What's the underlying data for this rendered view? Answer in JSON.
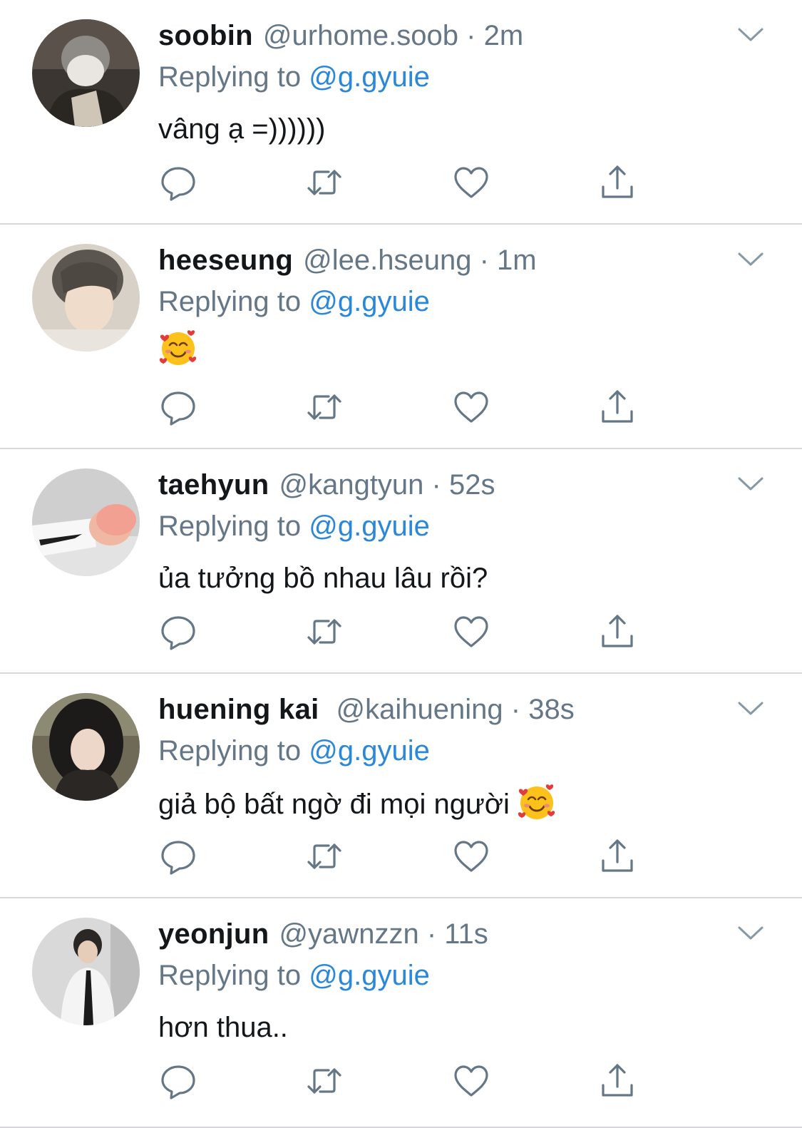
{
  "separator": "·",
  "reply_prefix": "Replying to",
  "tweets": [
    {
      "name": "soobin",
      "handle": "@urhome.soob",
      "time": "2m",
      "mention": "@g.gyuie",
      "text": "vâng ạ =))))))",
      "emoji": "",
      "avatar": "avatar-photo-masked-person"
    },
    {
      "name": "heeseung",
      "handle": "@lee.hseung",
      "time": "1m",
      "mention": "@g.gyuie",
      "text": "",
      "emoji": "smiling-face-with-hearts",
      "avatar": "avatar-photo-selfie"
    },
    {
      "name": "taehyun",
      "handle": "@kangtyun",
      "time": "52s",
      "mention": "@g.gyuie",
      "text": "ủa tưởng bồ nhau lâu rồi?",
      "emoji": "",
      "avatar": "avatar-photo-pink-hair"
    },
    {
      "name": "huening kai",
      "handle": "@kaihuening",
      "time": "38s",
      "mention": "@g.gyuie",
      "text": "giả bộ bất ngờ đi mọi người",
      "emoji": "smiling-face-with-hearts",
      "avatar": "avatar-photo-dark-hair"
    },
    {
      "name": "yeonjun",
      "handle": "@yawnzzn",
      "time": "11s",
      "mention": "@g.gyuie",
      "text": "hơn thua..",
      "emoji": "",
      "avatar": "avatar-photo-white-shirt"
    }
  ],
  "icons": {
    "reply": "reply-icon",
    "retweet": "retweet-icon",
    "like": "heart-icon",
    "share": "share-icon",
    "more": "chevron-down-icon"
  },
  "colors": {
    "name": "#14171a",
    "secondary": "#657786",
    "link": "#2b88d9",
    "divider": "#d7d7dc"
  }
}
